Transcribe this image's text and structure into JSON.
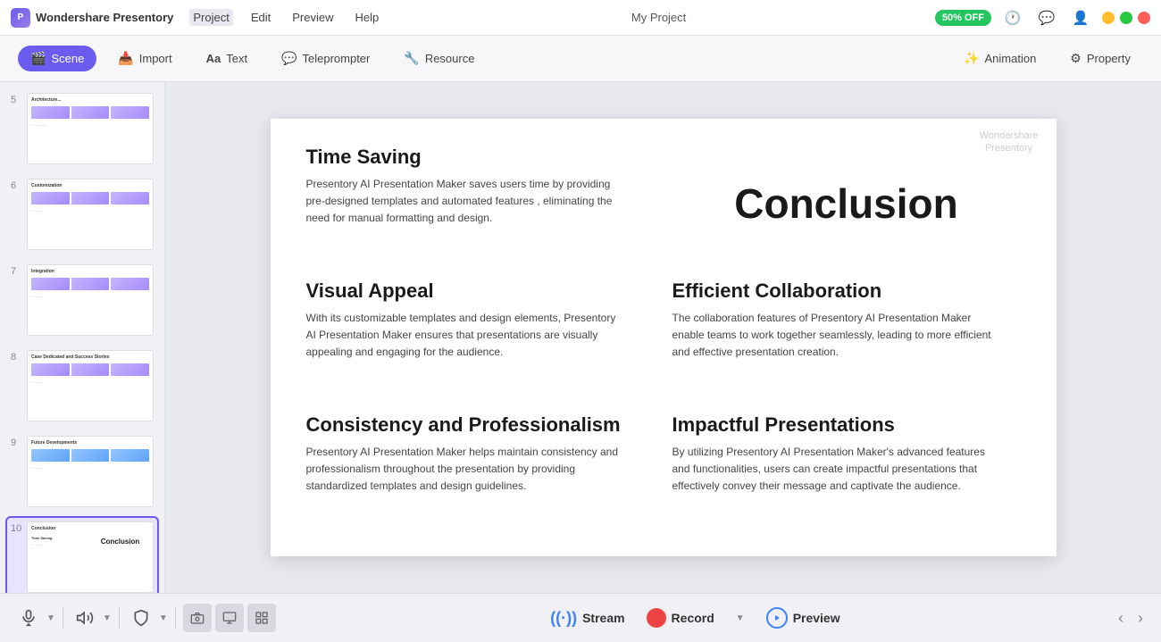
{
  "app": {
    "name": "Wondershare Presentory",
    "logo_text": "P",
    "title": "My Project"
  },
  "titlebar": {
    "menu": [
      "Project",
      "Edit",
      "Preview",
      "Help"
    ],
    "active_menu": "Project",
    "discount": "50% OFF",
    "window_controls": [
      "minimize",
      "maximize",
      "close"
    ]
  },
  "toolbar": {
    "buttons": [
      {
        "id": "scene",
        "label": "Scene",
        "icon": "🎬",
        "active": true
      },
      {
        "id": "import",
        "label": "Import",
        "icon": "📥",
        "active": false
      },
      {
        "id": "text",
        "label": "Text",
        "icon": "Aa",
        "active": false
      },
      {
        "id": "teleprompter",
        "label": "Teleprompter",
        "icon": "💬",
        "active": false
      },
      {
        "id": "resource",
        "label": "Resource",
        "icon": "🔧",
        "active": false
      },
      {
        "id": "animation",
        "label": "Animation",
        "icon": "✨",
        "active": false
      },
      {
        "id": "property",
        "label": "Property",
        "icon": "⚙",
        "active": false
      }
    ]
  },
  "slides": [
    {
      "number": "5",
      "title": "Architecture..."
    },
    {
      "number": "6",
      "title": "Customization"
    },
    {
      "number": "7",
      "title": "Integration"
    },
    {
      "number": "8",
      "title": "Case Dedicated and Success Stories"
    },
    {
      "number": "9",
      "title": "Future Developments"
    },
    {
      "number": "10",
      "title": "Conclusion",
      "active": true
    }
  ],
  "canvas": {
    "watermark": "Wondershare\nPresentory",
    "sections": [
      {
        "id": "time-saving",
        "title": "Time Saving",
        "body": "Presentory AI Presentation Maker saves users time by providing pre-designed templates and automated features , eliminating the need for manual formatting and design."
      },
      {
        "id": "conclusion",
        "title": "Conclusion",
        "is_large": true
      },
      {
        "id": "visual-appeal",
        "title": "Visual Appeal",
        "body": "With its customizable templates and design elements, Presentory AI Presentation Maker ensures that presentations are visually appealing and engaging for the audience."
      },
      {
        "id": "efficient-collaboration",
        "title": "Efficient Collaboration",
        "body": "The collaboration features of Presentory AI Presentation Maker enable teams to work together seamlessly, leading to more efficient and effective presentation creation."
      },
      {
        "id": "consistency",
        "title": "Consistency and Professionalism",
        "body": "Presentory AI Presentation Maker helps maintain consistency and professionalism throughout the presentation by providing standardized templates and design guidelines."
      },
      {
        "id": "impactful",
        "title": "Impactful Presentations",
        "body": "By utilizing Presentory AI Presentation Maker's advanced features and functionalities, users can create impactful presentations that effectively convey their message and captivate the audience."
      }
    ]
  },
  "bottom_bar": {
    "media_controls": [
      "🎤",
      "🔊",
      "🛡",
      "📷",
      "🖥",
      "📋"
    ],
    "stream_label": "Stream",
    "record_label": "Record",
    "preview_label": "Preview"
  }
}
